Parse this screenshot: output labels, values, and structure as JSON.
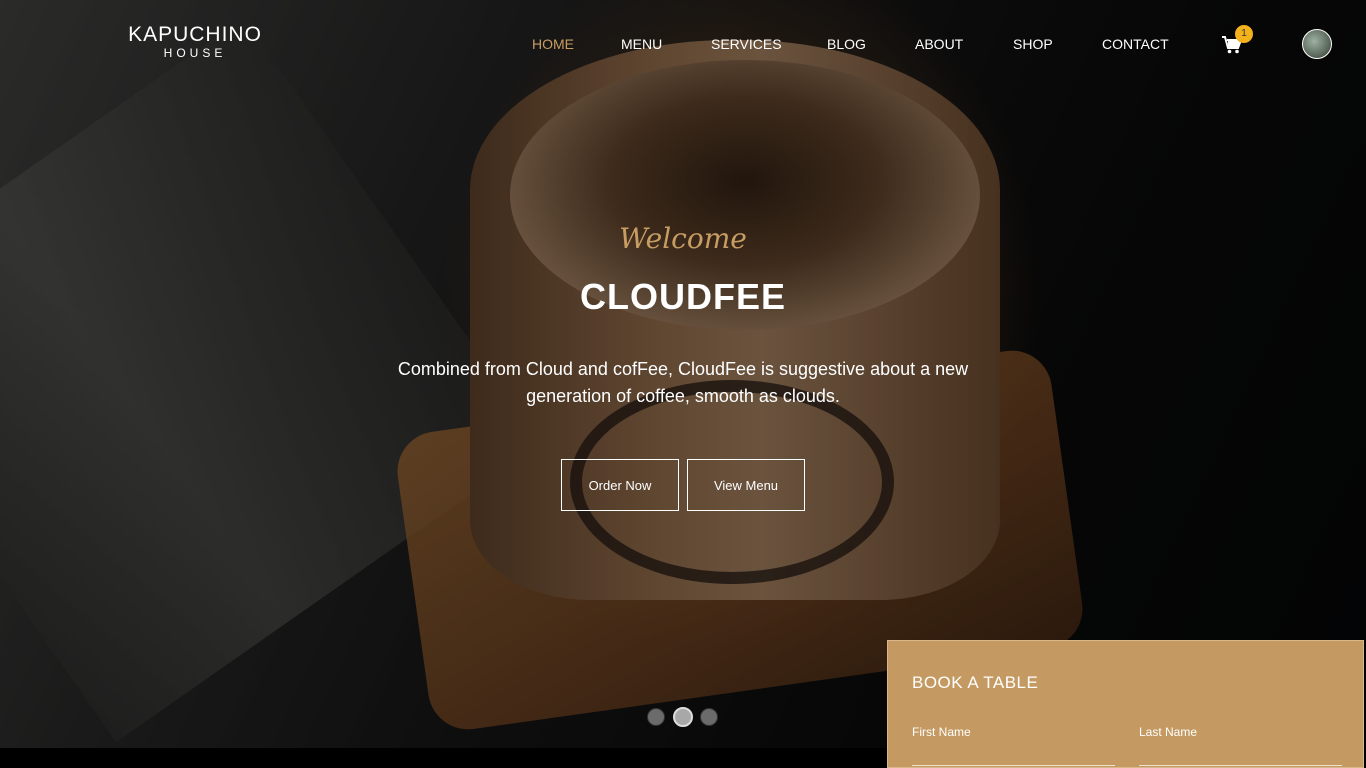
{
  "brand": {
    "main": "KAPUCHINO",
    "sub": "HOUSE"
  },
  "nav": {
    "items": [
      {
        "label": "HOME",
        "active": true
      },
      {
        "label": "MENU"
      },
      {
        "label": "SERVICES"
      },
      {
        "label": "BLOG"
      },
      {
        "label": "ABOUT"
      },
      {
        "label": "SHOP"
      },
      {
        "label": "CONTACT"
      }
    ],
    "cart_icon": "shopping-cart-icon",
    "cart_count": "1",
    "avatar": "user-avatar"
  },
  "hero": {
    "welcome": "Welcome",
    "title": "CLOUDFEE",
    "description": "Combined from Cloud and cofFee, CloudFee is suggestive about a new generation of coffee, smooth as clouds.",
    "order_button": "Order Now",
    "menu_button": "View Menu",
    "slide_count": 3,
    "active_slide": 2
  },
  "booking": {
    "title": "BOOK A TABLE",
    "first_name_label": "First Name",
    "last_name_label": "Last Name",
    "first_name_value": "",
    "last_name_value": ""
  },
  "colors": {
    "accent": "#c79d63",
    "panel": "#c49a62",
    "badge": "#f3b21b"
  }
}
